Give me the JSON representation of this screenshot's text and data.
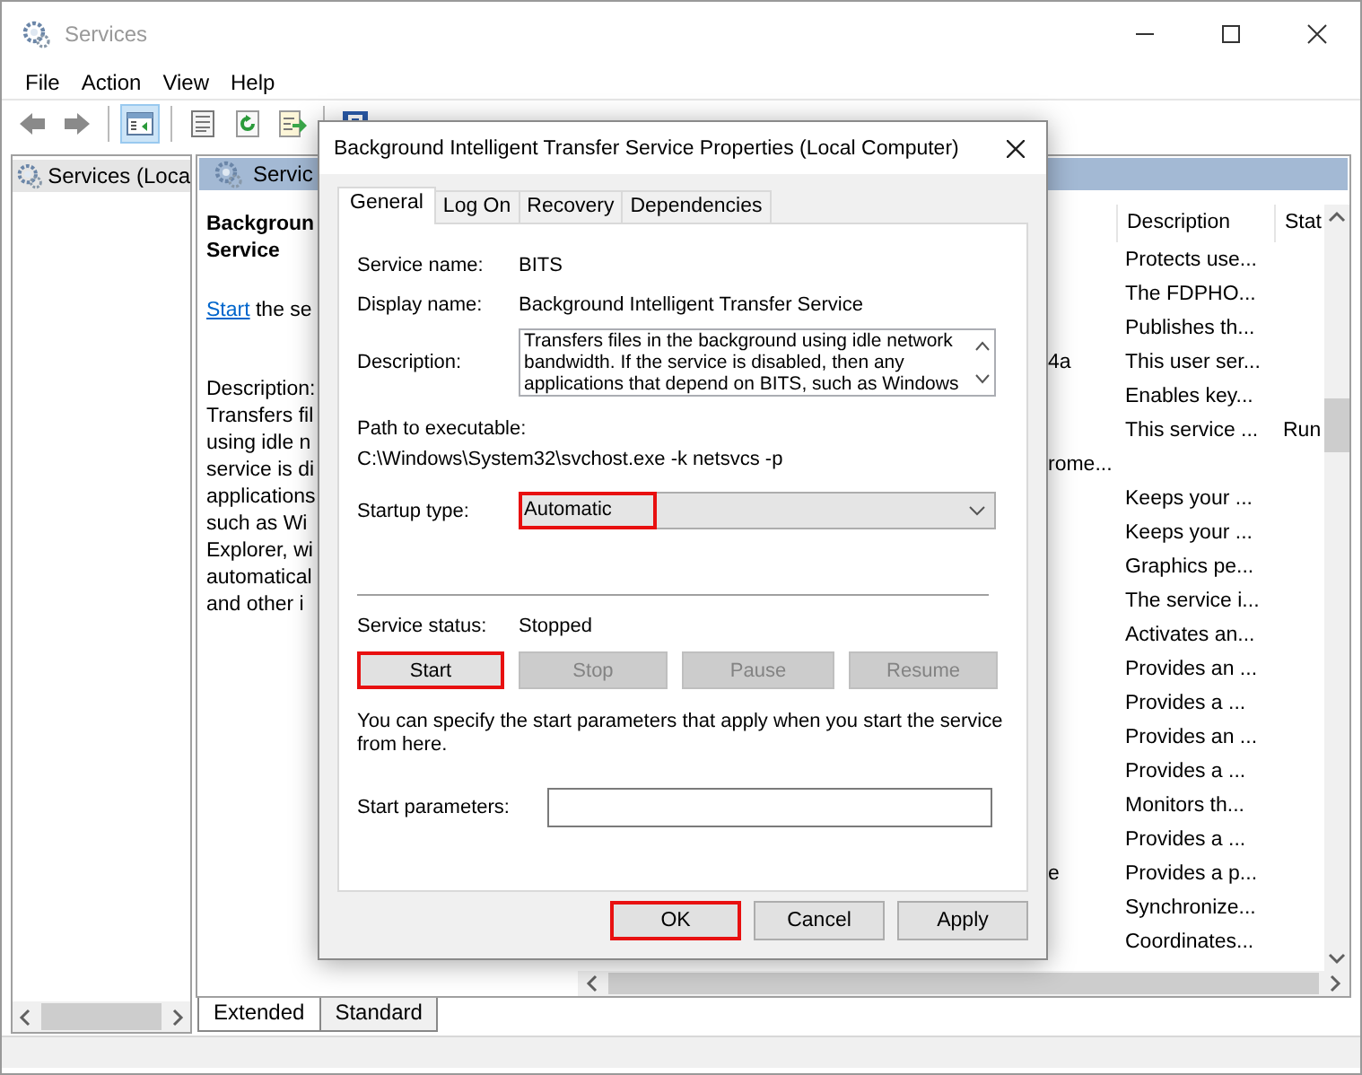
{
  "window": {
    "title": "Services"
  },
  "menu": [
    "File",
    "Action",
    "View",
    "Help"
  ],
  "toolbar": [
    {
      "kind": "back",
      "selected": false
    },
    {
      "kind": "forward",
      "selected": false
    },
    {
      "kind": "separator"
    },
    {
      "kind": "tree",
      "selected": true
    },
    {
      "kind": "separator"
    },
    {
      "kind": "properties",
      "selected": false
    },
    {
      "kind": "refresh",
      "selected": false
    },
    {
      "kind": "export",
      "selected": false
    },
    {
      "kind": "separator"
    },
    {
      "kind": "help",
      "selected": false
    }
  ],
  "tree": {
    "items": [
      {
        "label": "Services (Loca",
        "selected": true
      }
    ]
  },
  "pane": {
    "header": "Servic",
    "title_lines": [
      "Backgroun",
      "Service"
    ],
    "action_link": "Start",
    "action_text": "the se",
    "description_lines": [
      "Description:",
      "Transfers fil",
      "using idle n",
      "service is di",
      "applications",
      "such as Wi",
      "Explorer, wi",
      "automatical",
      "and other i"
    ]
  },
  "list": {
    "columns": [
      {
        "label": "Description"
      },
      {
        "label": "Stat"
      }
    ],
    "rows": [
      {
        "description": "Protects use..."
      },
      {
        "description": "The FDPHO..."
      },
      {
        "description": "Publishes th..."
      },
      {
        "name": "4a",
        "description": "This user ser..."
      },
      {
        "description": "Enables key..."
      },
      {
        "description": "This service ...",
        "status": "Run"
      },
      {
        "name": "rome..."
      },
      {
        "description": "Keeps your ..."
      },
      {
        "description": "Keeps your ..."
      },
      {
        "description": "Graphics pe..."
      },
      {
        "description": "The service i..."
      },
      {
        "description": "Activates an..."
      },
      {
        "description": "Provides an ..."
      },
      {
        "description": "Provides a ..."
      },
      {
        "description": "Provides an ..."
      },
      {
        "description": "Provides a ..."
      },
      {
        "description": "Monitors th..."
      },
      {
        "description": "Provides a ..."
      },
      {
        "name": "e",
        "description": "Provides a p..."
      },
      {
        "description": "Synchronize..."
      },
      {
        "description": "Coordinates..."
      }
    ]
  },
  "view_tabs": [
    {
      "label": "Extended",
      "selected": true
    },
    {
      "label": "Standard",
      "selected": false
    }
  ],
  "dialog": {
    "title": "Background Intelligent Transfer Service Properties (Local Computer)",
    "tabs": [
      {
        "label": "General",
        "selected": true
      },
      {
        "label": "Log On",
        "selected": false
      },
      {
        "label": "Recovery",
        "selected": false
      },
      {
        "label": "Dependencies",
        "selected": false
      }
    ],
    "fields": [
      {
        "label": "Service name:",
        "value": "BITS"
      },
      {
        "label": "Display name:",
        "value": "Background Intelligent Transfer Service"
      }
    ],
    "description": {
      "label": "Description:",
      "value": "Transfers files in the background using idle network bandwidth. If the service is disabled, then any applications that depend on BITS, such as Windows"
    },
    "path": {
      "label": "Path to executable:",
      "value": "C:\\Windows\\System32\\svchost.exe -k netsvcs -p"
    },
    "startup": {
      "label": "Startup type:",
      "value": "Automatic",
      "highlighted": true
    },
    "status": {
      "label": "Service status:",
      "value": "Stopped"
    },
    "service_buttons": [
      {
        "label": "Start",
        "disabled": false,
        "focused": true,
        "highlighted": true
      },
      {
        "label": "Stop",
        "disabled": true,
        "focused": false,
        "highlighted": false
      },
      {
        "label": "Pause",
        "disabled": true,
        "focused": false,
        "highlighted": false
      },
      {
        "label": "Resume",
        "disabled": true,
        "focused": false,
        "highlighted": false
      }
    ],
    "hint": "You can specify the start parameters that apply when you start the service from here.",
    "params": {
      "label": "Start parameters:"
    },
    "buttons": [
      {
        "label": "OK",
        "highlighted": true
      },
      {
        "label": "Cancel",
        "highlighted": false
      },
      {
        "label": "Apply",
        "highlighted": false
      }
    ]
  }
}
